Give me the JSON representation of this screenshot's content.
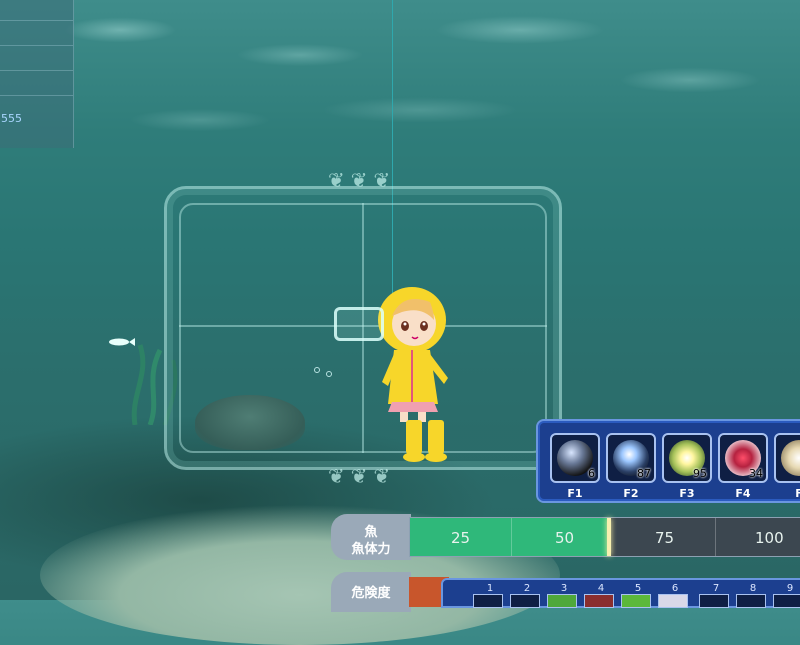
{
  "info_panel": {
    "value": "555"
  },
  "skills": [
    {
      "key": "F1",
      "count": "6"
    },
    {
      "key": "F2",
      "count": "87"
    },
    {
      "key": "F3",
      "count": "95"
    },
    {
      "key": "F4",
      "count": "34"
    },
    {
      "key": "F",
      "count": ""
    }
  ],
  "stamina": {
    "label_line1": "魚",
    "label_line2": "魚体力",
    "ticks": [
      "25",
      "50",
      "75",
      "100"
    ],
    "level_percent": 50,
    "colors": {
      "fill": "#2fb87a",
      "empty": "#3c4750"
    }
  },
  "danger": {
    "label": "危険度"
  },
  "hotbar": {
    "slot_numbers": [
      "1",
      "2",
      "3",
      "4",
      "5",
      "6",
      "7",
      "8",
      "9"
    ]
  }
}
